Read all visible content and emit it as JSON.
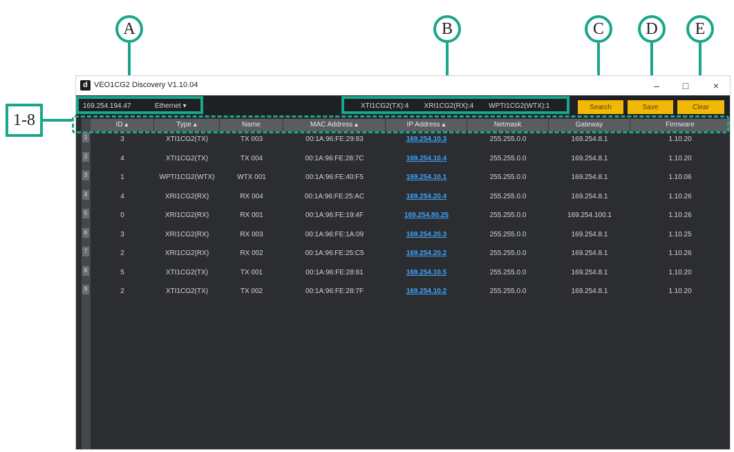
{
  "callouts": {
    "a": "A",
    "b": "B",
    "c": "C",
    "d": "D",
    "e": "E",
    "rows": "1-8"
  },
  "window": {
    "title": "VEO1CG2 Discovery V1.10.04",
    "icon": "d",
    "minimize": "–",
    "maximize": "□",
    "close": "×"
  },
  "toolbar": {
    "ip": "169.254.194.47",
    "interface": "Ethernet ▾",
    "counts": [
      "XTI1CG2(TX):4",
      "XRI1CG2(RX):4",
      "WPTI1CG2(WTX):1"
    ],
    "search": "Search",
    "save": "Save",
    "clear": "Clear"
  },
  "colors": {
    "accent": "#f2b807",
    "callout": "#1aa68a",
    "link": "#3ea3ff"
  },
  "table": {
    "headers": [
      "ID ▴",
      "Type ▴",
      "Name",
      "MAC Address ▴",
      "IP Address ▴",
      "Netmask",
      "Gateway",
      "Firmware"
    ],
    "rows": [
      {
        "n": "1",
        "id": "3",
        "type": "XTI1CG2(TX)",
        "name": "TX 003",
        "mac": "00:1A:96:FE:29:83",
        "ip": "169.254.10.3",
        "mask": "255.255.0.0",
        "gw": "169.254.8.1",
        "fw": "1.10.20"
      },
      {
        "n": "2",
        "id": "4",
        "type": "XTI1CG2(TX)",
        "name": "TX 004",
        "mac": "00:1A:96:FE:28:7C",
        "ip": "169.254.10.4",
        "mask": "255.255.0.0",
        "gw": "169.254.8.1",
        "fw": "1.10.20"
      },
      {
        "n": "3",
        "id": "1",
        "type": "WPTI1CG2(WTX)",
        "name": "WTX 001",
        "mac": "00:1A:96:FE:40:F5",
        "ip": "169.254.10.1",
        "mask": "255.255.0.0",
        "gw": "169.254.8.1",
        "fw": "1.10.06"
      },
      {
        "n": "4",
        "id": "4",
        "type": "XRI1CG2(RX)",
        "name": "RX 004",
        "mac": "00:1A:96:FE:25:AC",
        "ip": "169.254.20.4",
        "mask": "255.255.0.0",
        "gw": "169.254.8.1",
        "fw": "1.10.26"
      },
      {
        "n": "5",
        "id": "0",
        "type": "XRI1CG2(RX)",
        "name": "RX 001",
        "mac": "00:1A:96:FE:19:4F",
        "ip": "169.254.80.25",
        "mask": "255.255.0.0",
        "gw": "169.254.100.1",
        "fw": "1.10.26"
      },
      {
        "n": "6",
        "id": "3",
        "type": "XRI1CG2(RX)",
        "name": "RX 003",
        "mac": "00:1A:96:FE:1A:09",
        "ip": "169.254.20.3",
        "mask": "255.255.0.0",
        "gw": "169.254.8.1",
        "fw": "1.10.25"
      },
      {
        "n": "7",
        "id": "2",
        "type": "XRI1CG2(RX)",
        "name": "RX 002",
        "mac": "00:1A:96:FE:25:C5",
        "ip": "169.254.20.2",
        "mask": "255.255.0.0",
        "gw": "169.254.8.1",
        "fw": "1.10.26"
      },
      {
        "n": "8",
        "id": "5",
        "type": "XTI1CG2(TX)",
        "name": "TX 001",
        "mac": "00:1A:96:FE:28:81",
        "ip": "169.254.10.5",
        "mask": "255.255.0.0",
        "gw": "169.254.8.1",
        "fw": "1.10.20"
      },
      {
        "n": "9",
        "id": "2",
        "type": "XTI1CG2(TX)",
        "name": "TX 002",
        "mac": "00:1A:96:FE:28:7F",
        "ip": "169.254.10.2",
        "mask": "255.255.0.0",
        "gw": "169.254.8.1",
        "fw": "1.10.20"
      }
    ]
  }
}
